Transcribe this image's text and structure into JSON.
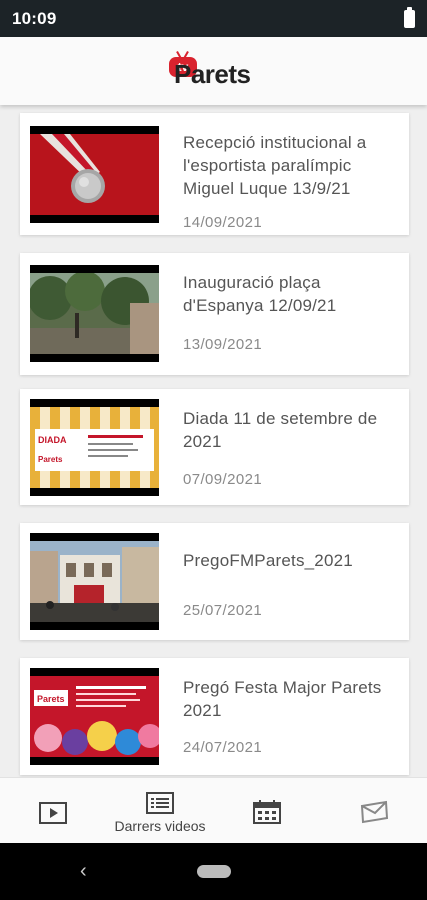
{
  "status_bar": {
    "time": "10:09",
    "battery_icon": "battery-icon"
  },
  "header": {
    "logo_tv": "tv",
    "logo_text": "Parets"
  },
  "videos": [
    {
      "title": "Recepció institucional a l'esportista paralímpic Miguel Luque 13/9/21",
      "date": "14/09/2021"
    },
    {
      "title": "Inauguració plaça d'Espanya 12/09/21",
      "date": "13/09/2021"
    },
    {
      "title": "Diada 11 de setembre de 2021",
      "date": "07/09/2021"
    },
    {
      "title": "PregoFMParets_2021",
      "date": "25/07/2021"
    },
    {
      "title": "Pregó Festa Major Parets 2021",
      "date": "24/07/2021"
    }
  ],
  "thumb_labels": {
    "diada_word": "DIADA",
    "diada_brand": "Parets",
    "prego_brand": "Parets"
  },
  "bottom_nav": [
    {
      "icon": "play-icon",
      "label": ""
    },
    {
      "icon": "list-icon",
      "label": "Darrers videos"
    },
    {
      "icon": "calendar-icon",
      "label": ""
    },
    {
      "icon": "mail-icon",
      "label": ""
    }
  ],
  "colors": {
    "brand_red": "#d9232e",
    "status_bar": "#1c2327"
  }
}
